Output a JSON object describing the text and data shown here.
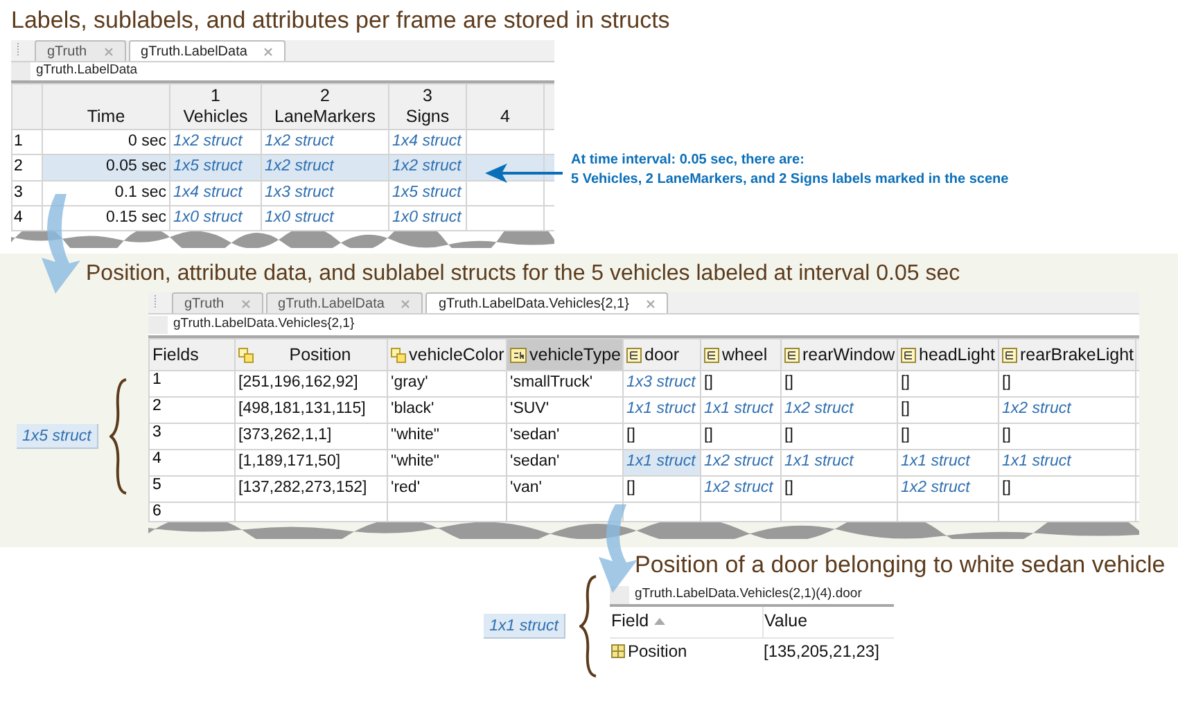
{
  "label_data": {
    "heading": "Labels, sublabels, and attributes per frame are stored in structs",
    "tabs": [
      {
        "label": "gTruth",
        "selected": false
      },
      {
        "label": "gTruth.LabelData",
        "selected": true
      }
    ],
    "path": "gTruth.LabelData",
    "columns": [
      {
        "name": "Time"
      },
      {
        "index": "1",
        "name": "Vehicles"
      },
      {
        "index": "2",
        "name": "LaneMarkers"
      },
      {
        "index": "3",
        "name": "Signs"
      },
      {
        "index": "4"
      }
    ],
    "rows": [
      {
        "index": "1",
        "selected": false,
        "cells": [
          {
            "kind": "time",
            "text": "0 sec"
          },
          {
            "kind": "struct",
            "text": "1x2 struct"
          },
          {
            "kind": "struct",
            "text": "1x2 struct"
          },
          {
            "kind": "struct",
            "text": "1x4 struct"
          }
        ]
      },
      {
        "index": "2",
        "selected": true,
        "cells": [
          {
            "kind": "time",
            "text": "0.05 sec"
          },
          {
            "kind": "struct",
            "text": "1x5 struct"
          },
          {
            "kind": "struct",
            "text": "1x2 struct"
          },
          {
            "kind": "struct",
            "text": "1x2 struct"
          }
        ]
      },
      {
        "index": "3",
        "selected": false,
        "cells": [
          {
            "kind": "time",
            "text": "0.1 sec"
          },
          {
            "kind": "struct",
            "text": "1x4 struct"
          },
          {
            "kind": "struct",
            "text": "1x3 struct"
          },
          {
            "kind": "struct",
            "text": "1x5 struct"
          }
        ]
      },
      {
        "index": "4",
        "selected": false,
        "cells": [
          {
            "kind": "time",
            "text": "0.15 sec"
          },
          {
            "kind": "struct",
            "text": "1x0 struct"
          },
          {
            "kind": "struct",
            "text": "1x0 struct"
          },
          {
            "kind": "struct",
            "text": "1x0 struct"
          }
        ]
      }
    ],
    "annotation": [
      "At time interval: 0.05 sec, there are:",
      "5 Vehicles, 2 LaneMarkers, and 2 Signs labels marked in the scene"
    ]
  },
  "vehicles": {
    "heading": "Position, attribute data, and sublabel structs for the 5 vehicles labeled at interval 0.05 sec",
    "tabs": [
      {
        "label": "gTruth",
        "selected": false
      },
      {
        "label": "gTruth.LabelData",
        "selected": false
      },
      {
        "label": "gTruth.LabelData.Vehicles{2,1}",
        "selected": true
      }
    ],
    "path": "gTruth.LabelData.Vehicles{2,1}",
    "size_label": "1x5 struct",
    "fields": [
      {
        "name": "Fields",
        "selected": false
      },
      {
        "name": "Position",
        "kind": "object",
        "selected": false
      },
      {
        "name": "vehicleColor",
        "kind": "object",
        "selected": false
      },
      {
        "name": "vehicleType",
        "kind": "char",
        "selected": true
      },
      {
        "name": "door",
        "kind": "struct",
        "selected": false
      },
      {
        "name": "wheel",
        "kind": "struct",
        "selected": false
      },
      {
        "name": "rearWindow",
        "kind": "struct",
        "selected": false
      },
      {
        "name": "headLight",
        "kind": "struct",
        "selected": false
      },
      {
        "name": "rearBrakeLight",
        "kind": "struct",
        "selected": false
      }
    ],
    "rows": [
      {
        "index": "1",
        "cells": [
          {
            "kind": "value",
            "text": "[251,196,162,92]",
            "selected": false
          },
          {
            "kind": "value",
            "text": "'gray'",
            "selected": false
          },
          {
            "kind": "value",
            "text": "'smallTruck'",
            "selected": false
          },
          {
            "kind": "struct",
            "text": "1x3 struct",
            "selected": false
          },
          {
            "kind": "value",
            "text": "[]",
            "selected": false
          },
          {
            "kind": "value",
            "text": "[]",
            "selected": false
          },
          {
            "kind": "value",
            "text": "[]",
            "selected": false
          },
          {
            "kind": "value",
            "text": "[]",
            "selected": false
          }
        ]
      },
      {
        "index": "2",
        "cells": [
          {
            "kind": "value",
            "text": "[498,181,131,115]",
            "selected": false
          },
          {
            "kind": "value",
            "text": "'black'",
            "selected": false
          },
          {
            "kind": "value",
            "text": "'SUV'",
            "selected": false
          },
          {
            "kind": "struct",
            "text": "1x1 struct",
            "selected": false
          },
          {
            "kind": "struct",
            "text": "1x1 struct",
            "selected": false
          },
          {
            "kind": "struct",
            "text": "1x2 struct",
            "selected": false
          },
          {
            "kind": "value",
            "text": "[]",
            "selected": false
          },
          {
            "kind": "struct",
            "text": "1x2 struct",
            "selected": false
          }
        ]
      },
      {
        "index": "3",
        "cells": [
          {
            "kind": "value",
            "text": "[373,262,1,1]",
            "selected": false
          },
          {
            "kind": "value",
            "text": "\"white\"",
            "selected": false
          },
          {
            "kind": "value",
            "text": "'sedan'",
            "selected": false
          },
          {
            "kind": "value",
            "text": "[]",
            "selected": false
          },
          {
            "kind": "value",
            "text": "[]",
            "selected": false
          },
          {
            "kind": "value",
            "text": "[]",
            "selected": false
          },
          {
            "kind": "value",
            "text": "[]",
            "selected": false
          },
          {
            "kind": "value",
            "text": "[]",
            "selected": false
          }
        ]
      },
      {
        "index": "4",
        "cells": [
          {
            "kind": "value",
            "text": "[1,189,171,50]",
            "selected": false
          },
          {
            "kind": "value",
            "text": "\"white\"",
            "selected": false
          },
          {
            "kind": "value",
            "text": "'sedan'",
            "selected": false
          },
          {
            "kind": "struct",
            "text": "1x1 struct",
            "selected": true
          },
          {
            "kind": "struct",
            "text": "1x2 struct",
            "selected": false
          },
          {
            "kind": "struct",
            "text": "1x1 struct",
            "selected": false
          },
          {
            "kind": "struct",
            "text": "1x1 struct",
            "selected": false
          },
          {
            "kind": "struct",
            "text": "1x1 struct",
            "selected": false
          }
        ]
      },
      {
        "index": "5",
        "cells": [
          {
            "kind": "value",
            "text": "[137,282,273,152]",
            "selected": false
          },
          {
            "kind": "value",
            "text": "'red'",
            "selected": false
          },
          {
            "kind": "value",
            "text": "'van'",
            "selected": false
          },
          {
            "kind": "value",
            "text": "[]",
            "selected": false
          },
          {
            "kind": "struct",
            "text": "1x2 struct",
            "selected": false
          },
          {
            "kind": "value",
            "text": "[]",
            "selected": false
          },
          {
            "kind": "struct",
            "text": "1x2 struct",
            "selected": false
          },
          {
            "kind": "value",
            "text": "[]",
            "selected": false
          }
        ]
      },
      {
        "index": "6",
        "cells": []
      }
    ]
  },
  "door": {
    "heading": "Position of a door belonging to white sedan vehicle",
    "path": "gTruth.LabelData.Vehicles(2,1)(4).door",
    "size_label": "1x1 struct",
    "columns": [
      {
        "name": "Field",
        "sorted": true
      },
      {
        "name": "Value",
        "sorted": false
      }
    ],
    "rows": [
      {
        "field": "Position",
        "value": "[135,205,21,23]"
      }
    ]
  }
}
